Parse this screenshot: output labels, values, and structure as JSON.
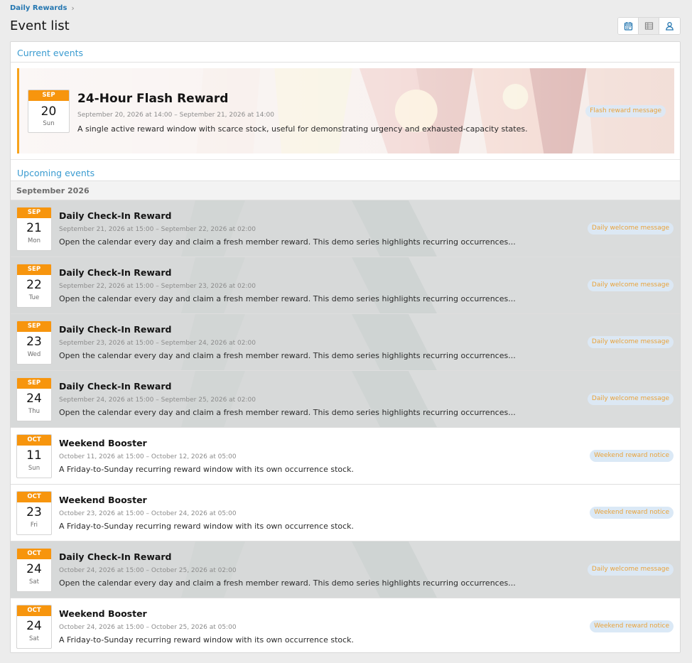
{
  "breadcrumb": {
    "label": "Daily Rewards"
  },
  "page": {
    "title": "Event list"
  },
  "view_toggle": [
    {
      "name": "calendar-view",
      "icon": "calendar-icon"
    },
    {
      "name": "table-view",
      "icon": "table-icon"
    },
    {
      "name": "user-view",
      "icon": "user-icon"
    }
  ],
  "sections": {
    "current": "Current events",
    "upcoming": "Upcoming events",
    "month": "September 2026"
  },
  "current_event": {
    "month": "SEP",
    "day": "20",
    "dow": "Sun",
    "title": "24-Hour Flash Reward",
    "date": "September 20, 2026 at 14:00 – September 21, 2026 at 14:00",
    "desc": "A single active reward window with scarce stock, useful for demonstrating urgency and exhausted-capacity states.",
    "tag": "Flash reward message"
  },
  "upcoming_events": [
    {
      "month": "SEP",
      "day": "21",
      "dow": "Mon",
      "title": "Daily Check-In Reward",
      "date": "September 21, 2026 at 15:00 – September 22, 2026 at 02:00",
      "desc": "Open the calendar every day and claim a fresh member reward. This demo series highlights recurring occurrences...",
      "tag": "Daily welcome message",
      "image": true
    },
    {
      "month": "SEP",
      "day": "22",
      "dow": "Tue",
      "title": "Daily Check-In Reward",
      "date": "September 22, 2026 at 15:00 – September 23, 2026 at 02:00",
      "desc": "Open the calendar every day and claim a fresh member reward. This demo series highlights recurring occurrences...",
      "tag": "Daily welcome message",
      "image": true
    },
    {
      "month": "SEP",
      "day": "23",
      "dow": "Wed",
      "title": "Daily Check-In Reward",
      "date": "September 23, 2026 at 15:00 – September 24, 2026 at 02:00",
      "desc": "Open the calendar every day and claim a fresh member reward. This demo series highlights recurring occurrences...",
      "tag": "Daily welcome message",
      "image": true
    },
    {
      "month": "SEP",
      "day": "24",
      "dow": "Thu",
      "title": "Daily Check-In Reward",
      "date": "September 24, 2026 at 15:00 – September 25, 2026 at 02:00",
      "desc": "Open the calendar every day and claim a fresh member reward. This demo series highlights recurring occurrences...",
      "tag": "Daily welcome message",
      "image": true
    },
    {
      "month": "OCT",
      "day": "11",
      "dow": "Sun",
      "title": "Weekend Booster",
      "date": "October 11, 2026 at 15:00 – October 12, 2026 at 05:00",
      "desc": "A Friday-to-Sunday recurring reward window with its own occurrence stock.",
      "tag": "Weekend reward notice",
      "image": false
    },
    {
      "month": "OCT",
      "day": "23",
      "dow": "Fri",
      "title": "Weekend Booster",
      "date": "October 23, 2026 at 15:00 – October 24, 2026 at 05:00",
      "desc": "A Friday-to-Sunday recurring reward window with its own occurrence stock.",
      "tag": "Weekend reward notice",
      "image": false
    },
    {
      "month": "OCT",
      "day": "24",
      "dow": "Sat",
      "title": "Daily Check-In Reward",
      "date": "October 24, 2026 at 15:00 – October 25, 2026 at 02:00",
      "desc": "Open the calendar every day and claim a fresh member reward. This demo series highlights recurring occurrences...",
      "tag": "Daily welcome message",
      "image": true
    },
    {
      "month": "OCT",
      "day": "24",
      "dow": "Sat",
      "title": "Weekend Booster",
      "date": "October 24, 2026 at 15:00 – October 25, 2026 at 05:00",
      "desc": "A Friday-to-Sunday recurring reward window with its own occurrence stock.",
      "tag": "Weekend reward notice",
      "image": false
    }
  ],
  "colors": {
    "accent": "#f7950d",
    "link": "#2577b1",
    "section": "#3a9bd0",
    "tag_bg": "#dbe9f6",
    "tag_text": "#e8a23a"
  }
}
